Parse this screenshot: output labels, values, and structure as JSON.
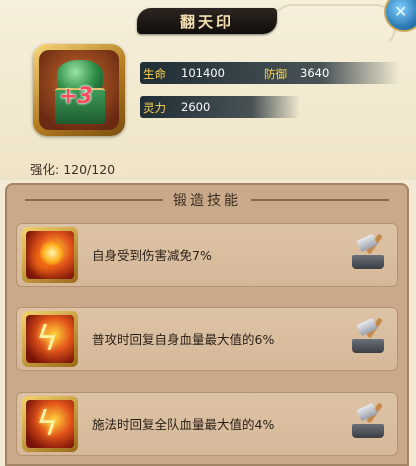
{
  "title": "翻天印",
  "close_icon": "close-icon",
  "item": {
    "icon": "jade-seal-icon",
    "plus_level": "+3",
    "stars": "★★★"
  },
  "stats": {
    "hp_label": "生命",
    "hp_value": "101400",
    "def_label": "防御",
    "def_value": "3640",
    "spirit_label": "灵力",
    "spirit_value": "2600"
  },
  "enhance": {
    "label": "强化:",
    "value": "120/120"
  },
  "skills": {
    "header": "锻造技能",
    "items": [
      {
        "icon": "fireball-icon",
        "text": "自身受到伤害减免7%"
      },
      {
        "icon": "lightning-slash-icon",
        "text": "普攻时回复自身血量最大值的6%"
      },
      {
        "icon": "lightning-slash-icon",
        "text": "施法时回复全队血量最大值的4%"
      }
    ]
  },
  "colors": {
    "stat_label": "#ffd54a",
    "title_text": "#f3e0b2",
    "panel": "#c9a989"
  }
}
